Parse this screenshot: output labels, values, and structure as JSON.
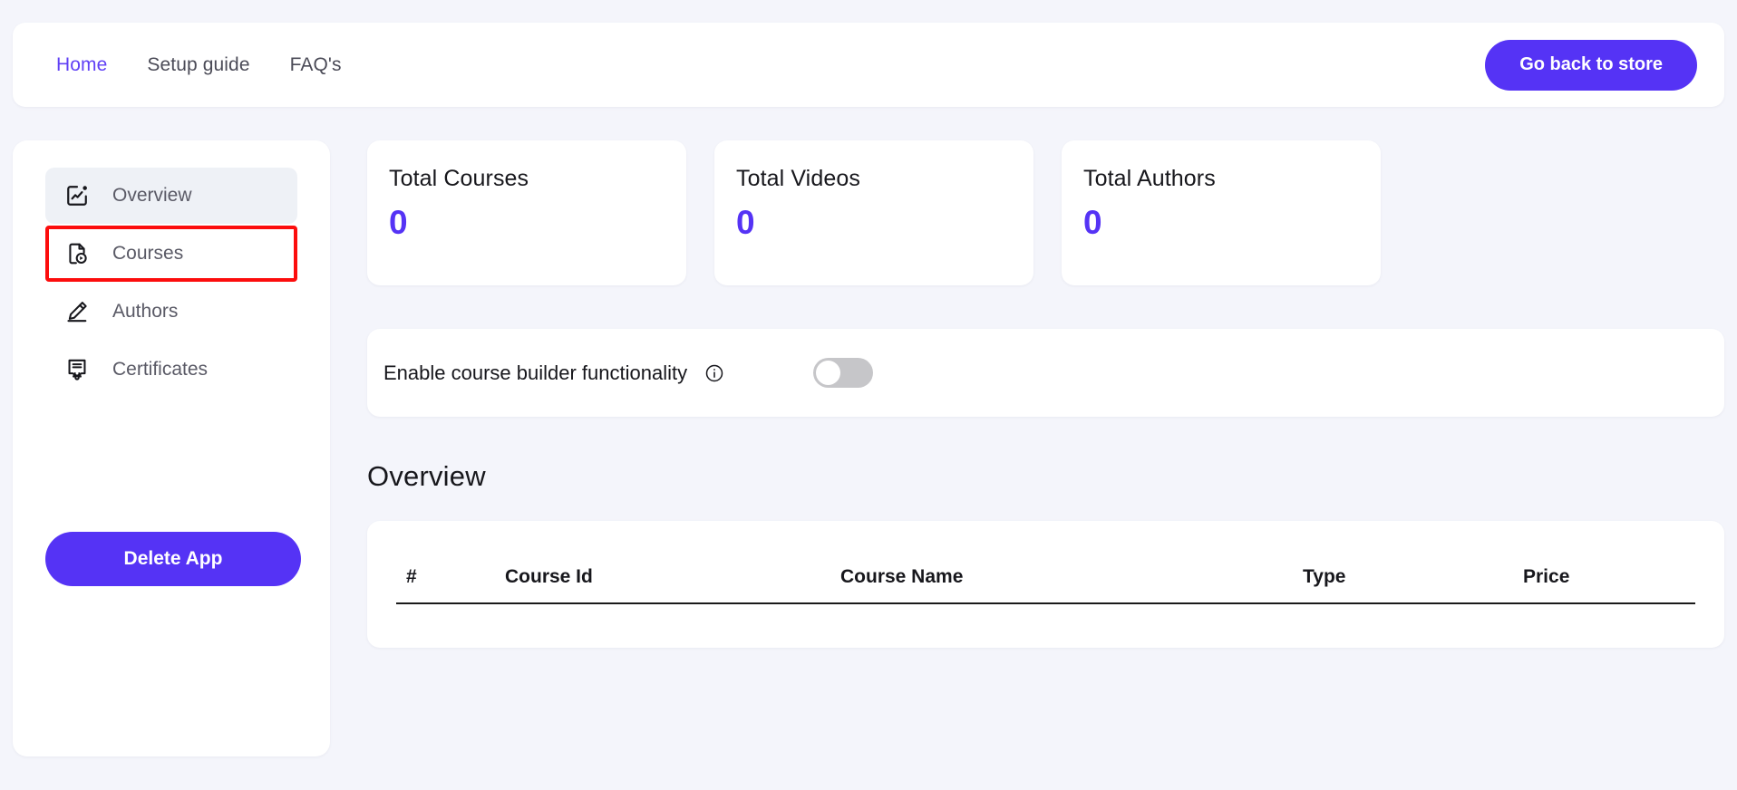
{
  "topnav": {
    "links": [
      {
        "label": "Home",
        "active": true
      },
      {
        "label": "Setup guide",
        "active": false
      },
      {
        "label": "FAQ's",
        "active": false
      }
    ],
    "store_button": "Go back to store"
  },
  "sidebar": {
    "items": [
      {
        "label": "Overview",
        "icon": "chart-square-icon",
        "state": "active"
      },
      {
        "label": "Courses",
        "icon": "course-video-file-icon",
        "state": "highlighted"
      },
      {
        "label": "Authors",
        "icon": "pencil-icon",
        "state": "default"
      },
      {
        "label": "Certificates",
        "icon": "certificate-icon",
        "state": "default"
      }
    ],
    "delete_button": "Delete App"
  },
  "stats": [
    {
      "title": "Total Courses",
      "value": "0"
    },
    {
      "title": "Total Videos",
      "value": "0"
    },
    {
      "title": "Total Authors",
      "value": "0"
    }
  ],
  "course_builder": {
    "label": "Enable course builder functionality",
    "info_icon": "info-circle-icon",
    "toggle_state": "off"
  },
  "overview": {
    "heading": "Overview",
    "table": {
      "columns": [
        "#",
        "Course Id",
        "Course Name",
        "Type",
        "Price"
      ],
      "rows": []
    }
  },
  "colors": {
    "accent": "#5533f5",
    "accent_link": "#6040f5",
    "page_background": "#f4f5fb",
    "card_background": "#ffffff",
    "highlight_border": "#fc0d0d",
    "sidebar_active_background": "#eef1f6",
    "toggle_off": "#c6c6c9"
  }
}
